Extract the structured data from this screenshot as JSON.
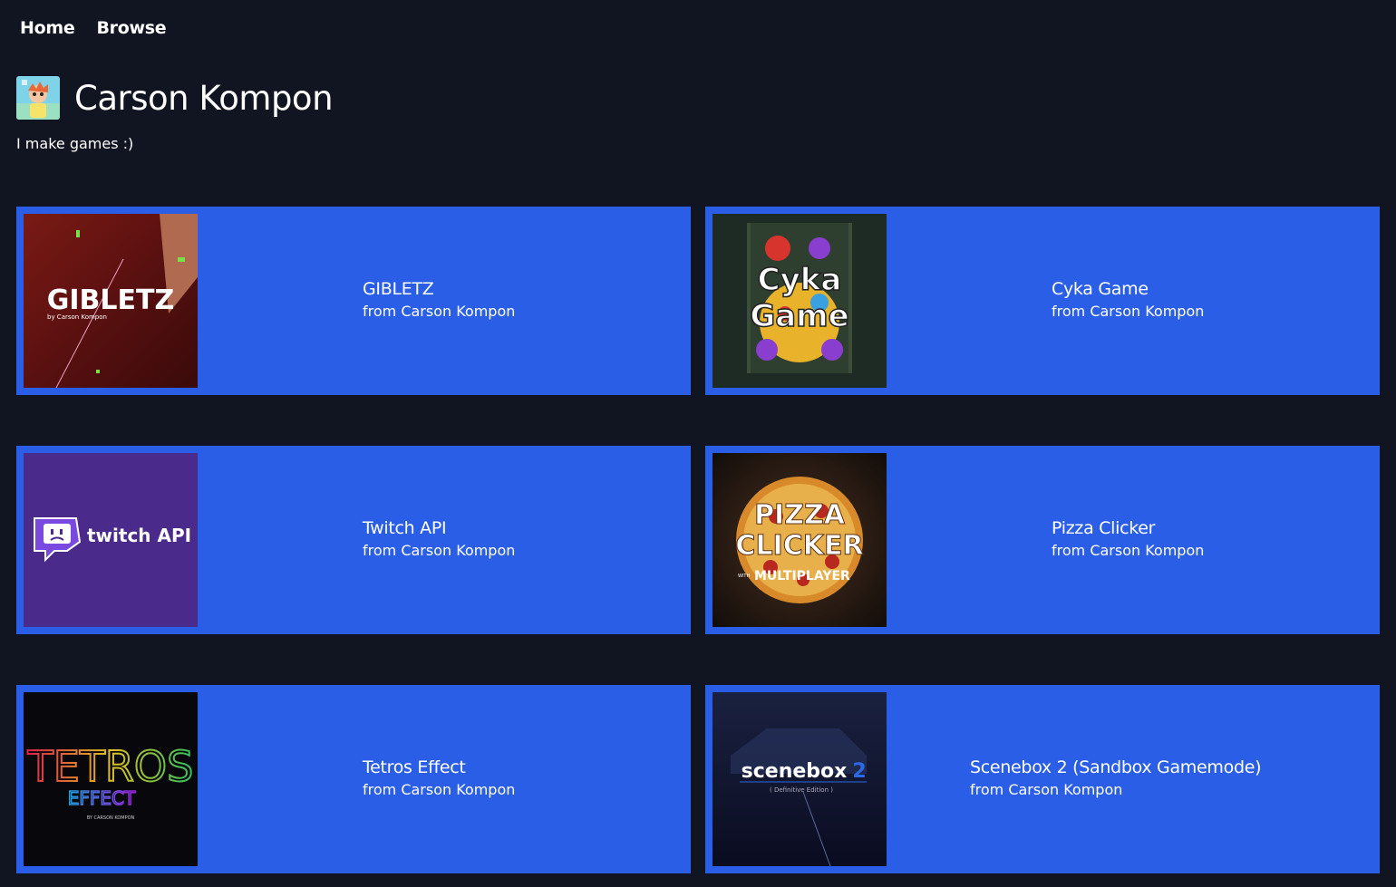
{
  "nav": {
    "home": "Home",
    "browse": "Browse"
  },
  "profile": {
    "name": "Carson Kompon",
    "bio": "I make games :)"
  },
  "games": [
    {
      "title": "GIBLETZ",
      "from": "from Carson Kompon",
      "thumb_text": "GIBLETZ",
      "thumb_sub": "by Carson Kompon"
    },
    {
      "title": "Cyka Game",
      "from": "from Carson Kompon",
      "thumb_text": "Cyka",
      "thumb_text2": "Game"
    },
    {
      "title": "Twitch API",
      "from": "from Carson Kompon",
      "thumb_text": "twitch API"
    },
    {
      "title": "Pizza Clicker",
      "from": "from Carson Kompon",
      "thumb_text": "PIZZA",
      "thumb_text2": "CLICKER",
      "thumb_sub": "MULTIPLAYER",
      "thumb_sub2": "WITH"
    },
    {
      "title": "Tetros Effect",
      "from": "from Carson Kompon",
      "thumb_text": "TETROS",
      "thumb_text2": "EFFECT",
      "thumb_sub": "BY CARSON KOMPON"
    },
    {
      "title": "Scenebox 2 (Sandbox Gamemode)",
      "from": "from Carson Kompon",
      "thumb_text": "scenebox",
      "thumb_text2": "2",
      "thumb_sub": "( Definitive Edition )"
    }
  ],
  "colors": {
    "background": "#111521",
    "card": "#2a5ee6",
    "text": "#ffffff"
  }
}
